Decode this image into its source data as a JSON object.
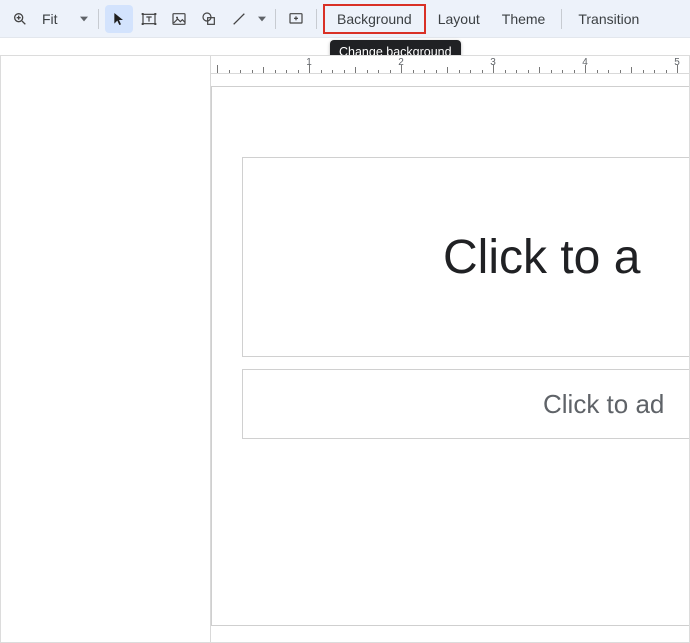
{
  "toolbar": {
    "zoom_value": "Fit",
    "background_label": "Background",
    "layout_label": "Layout",
    "theme_label": "Theme",
    "transition_label": "Transition"
  },
  "tooltip": {
    "background": "Change background"
  },
  "ruler": {
    "labels": [
      "1",
      "2",
      "3",
      "4",
      "5"
    ]
  },
  "slide": {
    "title_placeholder": "Click to a",
    "subtitle_placeholder": "Click to ad"
  }
}
